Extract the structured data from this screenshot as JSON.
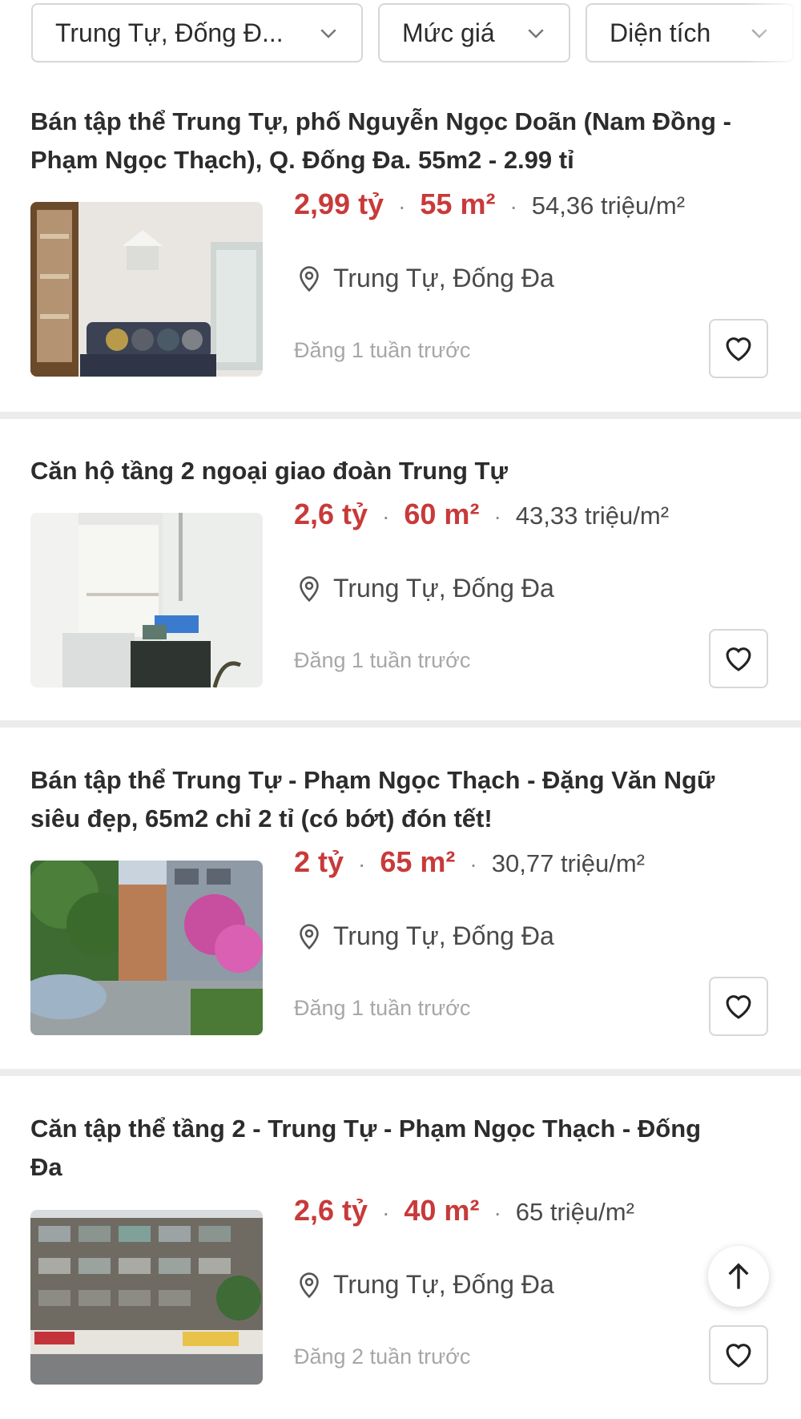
{
  "filters": [
    {
      "label": "Trung Tự, Đống Đ..."
    },
    {
      "label": "Mức giá"
    },
    {
      "label": "Diện tích"
    }
  ],
  "listings": [
    {
      "title": "Bán tập thể Trung Tự, phố Nguyễn Ngọc Doãn (Nam Đồng - Phạm Ngọc Thạch), Q. Đống Đa. 55m2 - 2.99 tỉ",
      "price": "2,99 tỷ",
      "area": "55 m²",
      "price_per_m2": "54,36 triệu/m²",
      "location": "Trung Tự, Đống Đa",
      "posted": "Đăng 1 tuần trước",
      "image": "living-room-photo"
    },
    {
      "title": "Căn hộ tầng 2 ngoại giao đoàn Trung Tự",
      "price": "2,6 tỷ",
      "area": "60 m²",
      "price_per_m2": "43,33 triệu/m²",
      "location": "Trung Tự, Đống Đa",
      "posted": "Đăng 1 tuần trước",
      "image": "kitchen-room-photo"
    },
    {
      "title": "Bán tập thể Trung Tự - Phạm Ngọc Thạch - Đặng Văn Ngữ siêu đẹp, 65m2 chỉ 2 tỉ (có bớt) đón tết!",
      "price": "2 tỷ",
      "area": "65 m²",
      "price_per_m2": "30,77 triệu/m²",
      "location": "Trung Tự, Đống Đa",
      "posted": "Đăng 1 tuần trước",
      "image": "street-flowers-photo"
    },
    {
      "title": "Căn tập thể tầng 2 - Trung Tự - Phạm Ngọc Thạch - Đống Đa",
      "price": "2,6 tỷ",
      "area": "40 m²",
      "price_per_m2": "65 triệu/m²",
      "location": "Trung Tự, Đống Đa",
      "posted": "Đăng 2 tuần trước",
      "image": "apartment-block-photo"
    }
  ],
  "colors": {
    "price": "#c83a3a",
    "separator": "#ececec",
    "border": "#d7d7d7",
    "muted_text": "#a7a7a7"
  },
  "icons": {
    "chevron": "chevron-down-icon",
    "location": "map-pin-icon",
    "favorite": "heart-icon",
    "scroll_top": "arrow-up-icon"
  }
}
